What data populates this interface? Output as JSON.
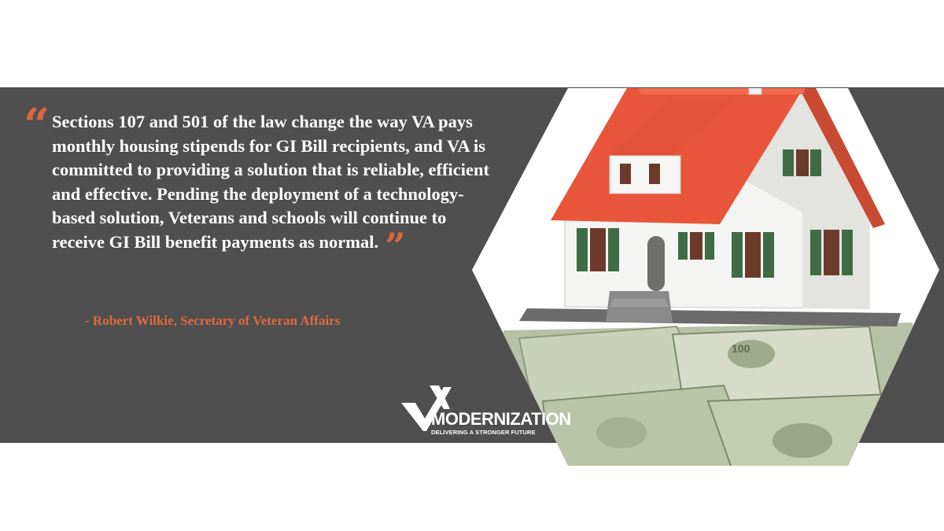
{
  "quote": {
    "open_mark": "“",
    "text": "Sections 107 and 501 of the law change the way VA pays monthly housing stipends for GI Bill recipients, and VA is committed to providing a solution that is reliable, efficient and effective. Pending the deployment of a technology-based solution, Veterans and schools will continue to receive GI Bill benefit payments as normal.",
    "close_mark": "”"
  },
  "attribution": "- Robert Wilkie, Secretary of Veteran Affairs",
  "logo": {
    "word": "MODERNIZATION",
    "tagline": "DELIVERING A STRONGER FUTURE"
  },
  "colors": {
    "band": "#4f4f4f",
    "accent": "#d9673f",
    "roof": "#e8553a",
    "walls": "#f4f4f2",
    "shutters": "#3f6b45",
    "money": "#a9b59a"
  },
  "image": {
    "icon": "house-on-money-icon"
  }
}
